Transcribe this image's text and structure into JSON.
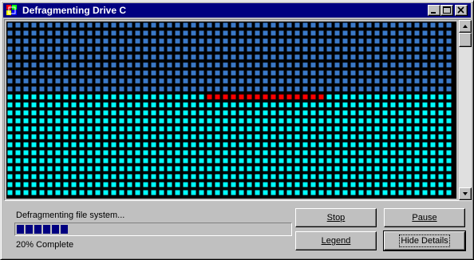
{
  "window": {
    "title": "Defragmenting Drive C"
  },
  "disk_map": {
    "colors": {
      "optimized": "#3a79c8",
      "unoptimized": "#00ffff",
      "in_progress": "#ff0000",
      "outline": "#000000"
    },
    "columns": 56,
    "rows": 22,
    "optimized_rows": 9,
    "in_progress_row": 9,
    "in_progress_start_col": 25,
    "in_progress_count": 15
  },
  "status": {
    "message": "Defragmenting file system...",
    "percent_text": "20% Complete",
    "progress_fraction": 0.2,
    "progress_color": "#000080"
  },
  "buttons": {
    "stop": "Stop",
    "pause": "Pause",
    "legend": "Legend",
    "details": "Hide Details"
  },
  "icons": {
    "app": "defrag-icon",
    "minimize": "minimize-icon",
    "maximize": "maximize-icon",
    "close": "close-icon",
    "scroll_up": "arrow-up-icon",
    "scroll_down": "arrow-down-icon"
  }
}
